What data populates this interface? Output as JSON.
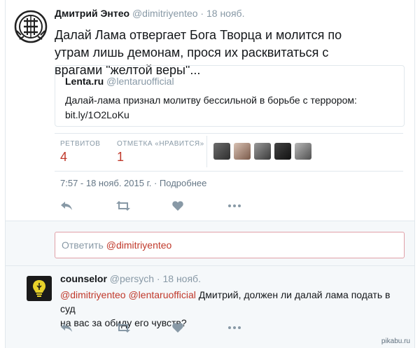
{
  "colors": {
    "accent": "#c0392b",
    "muted": "#8899a6",
    "border": "#e1e8ed"
  },
  "main_tweet": {
    "author_name": "Дмитрий Энтео",
    "author_handle": "@dimitriyenteo",
    "separator": "·",
    "time": "18 нояб.",
    "text": "Далай Лама отвергает Бога Творца и молится по утрам лишь демонам, прося их расквитаться с врагами \"желтой веры\"...",
    "quote": {
      "author_name": "Lenta.ru",
      "author_handle": "@lentaruofficial",
      "text_line1": "Далай-лама признал молитву бессильной в борьбе с террором:",
      "text_line2": "bit.ly/1O2LoKu"
    },
    "stats": {
      "retweets_label": "РЕТВИТОВ",
      "retweets_value": "4",
      "likes_label": "ОТМЕТКА «НРАВИТСЯ»",
      "likes_value": "1"
    },
    "timestamp": "7:57 - 18 нояб. 2015 г.",
    "details_link": "Подробнее",
    "actions": [
      "reply-icon",
      "retweet-icon",
      "heart-icon",
      "more-icon"
    ]
  },
  "reply_box": {
    "prefix": "Ответить ",
    "mention": "@dimitriyenteo"
  },
  "reply_tweet": {
    "author_name": "counselor",
    "author_handle": "@persych",
    "separator": "·",
    "time": "18 нояб.",
    "mention1": "@dimitriyenteo",
    "mention2": "@lentaruofficial",
    "text_line1": " Дмитрий, должен ли далай лама подать в суд",
    "text_line2": "на вас за обиду его чувств?"
  },
  "watermark": "pikabu.ru"
}
